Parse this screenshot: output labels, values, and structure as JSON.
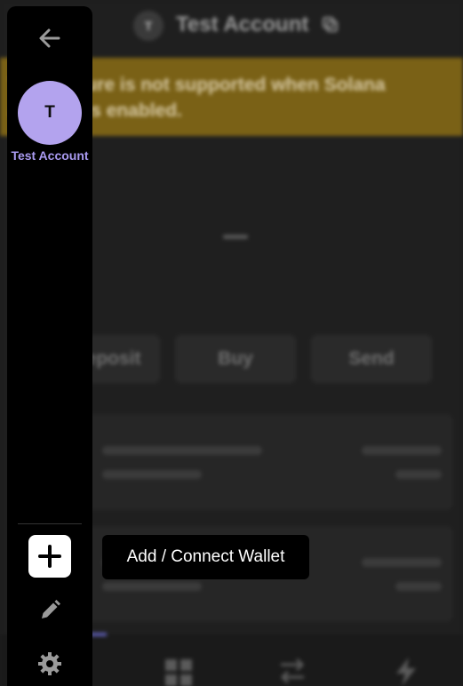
{
  "header": {
    "account_initial": "T",
    "account_name": "Test Account"
  },
  "banner": {
    "text": "This feature is not supported when Solana account is enabled."
  },
  "balance": {
    "placeholder": "—"
  },
  "actions": [
    {
      "label": "Deposit"
    },
    {
      "label": "Buy"
    },
    {
      "label": "Send"
    }
  ],
  "sidebar": {
    "account": {
      "initial": "T",
      "label": "Test Account"
    }
  },
  "tooltip": {
    "text": "Add / Connect Wallet"
  },
  "colors": {
    "avatar_bg": "#b3a3ee",
    "account_label": "#a99af0",
    "banner_bg": "#7a6116",
    "sidebar_bg": "#000000"
  },
  "icons": [
    "back-arrow-icon",
    "copy-icon",
    "plus-icon",
    "pencil-icon",
    "gear-icon",
    "grid-icon",
    "swap-icon",
    "lightning-icon"
  ]
}
